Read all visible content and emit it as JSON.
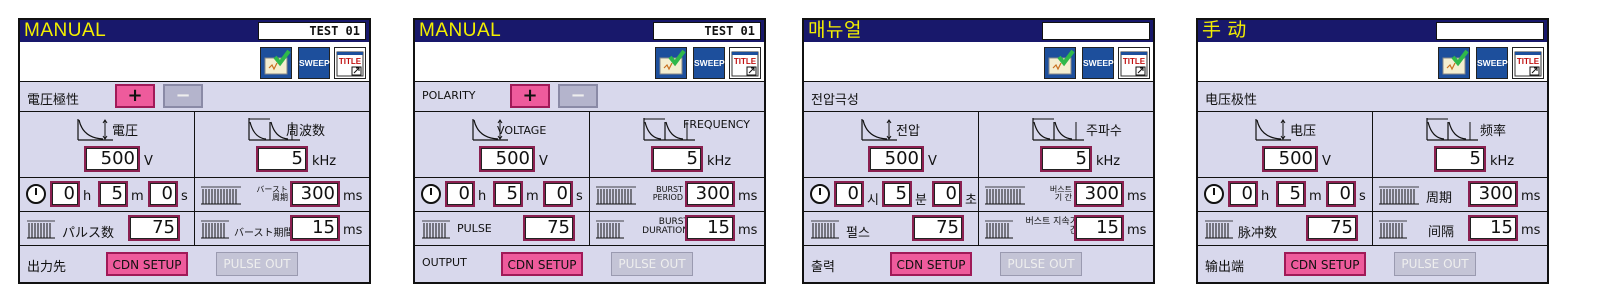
{
  "icons": {
    "calibrate": "calibration-icon",
    "sweep_label": "SWEEP",
    "title_label": "TITLE"
  },
  "colors": {
    "titlebar": "#18186b",
    "mode_text": "#f4f000",
    "active": "#ee5b9c",
    "inactive": "#b4b4cc",
    "panel_bg": "#d8d8ec"
  },
  "panels": [
    {
      "mode": "MANUAL",
      "test": "TEST 01",
      "polarity": "電圧極性",
      "plus": "+",
      "minus": "−",
      "voltage": "電圧",
      "frequency": "周波数",
      "volt_value": "500",
      "volt_unit": "V",
      "freq_value": "5",
      "freq_unit": "kHz",
      "h_value": "0",
      "h_unit": "h",
      "m_value": "5",
      "m_unit": "m",
      "s_value": "0",
      "s_unit": "s",
      "burst_period_1": "バースト",
      "burst_period_2": "周期",
      "burst_period_value": "300",
      "ms1": "ms",
      "pulse": "パルス数",
      "pulse_value": "75",
      "burst_dur": "バースト期間",
      "burst_dur_value": "15",
      "ms2": "ms",
      "output": "出力先",
      "cdn": "CDN SETUP",
      "pulse_out": "PULSE OUT"
    },
    {
      "mode": "MANUAL",
      "test": "TEST 01",
      "polarity": "POLARITY",
      "plus": "+",
      "minus": "−",
      "voltage": "VOLTAGE",
      "frequency": "FREQUENCY",
      "volt_value": "500",
      "volt_unit": "V",
      "freq_value": "5",
      "freq_unit": "kHz",
      "h_value": "0",
      "h_unit": "h",
      "m_value": "5",
      "m_unit": "m",
      "s_value": "0",
      "s_unit": "s",
      "burst_period_1": "BURST",
      "burst_period_2": "PERIOD",
      "burst_period_value": "300",
      "ms1": "ms",
      "pulse": "PULSE",
      "pulse_value": "75",
      "burst_dur": "BURST DURATION",
      "burst_dur_value": "15",
      "ms2": "ms",
      "output": "OUTPUT",
      "cdn": "CDN SETUP",
      "pulse_out": "PULSE OUT"
    },
    {
      "mode": "매뉴얼",
      "test": "",
      "polarity": "전압극성",
      "plus": "",
      "minus": "",
      "voltage": "전압",
      "frequency": "주파수",
      "volt_value": "500",
      "volt_unit": "V",
      "freq_value": "5",
      "freq_unit": "kHz",
      "h_value": "0",
      "h_unit": "시",
      "m_value": "5",
      "m_unit": "분",
      "s_value": "0",
      "s_unit": "초",
      "burst_period_1": "버스트",
      "burst_period_2": "기 간",
      "burst_period_value": "300",
      "ms1": "ms",
      "pulse": "펄스",
      "pulse_value": "75",
      "burst_dur": "버스트 지속기간",
      "burst_dur_value": "15",
      "ms2": "ms",
      "output": "출력",
      "cdn": "CDN SETUP",
      "pulse_out": "PULSE OUT"
    },
    {
      "mode": "手 动",
      "test": "",
      "polarity": "电压极性",
      "plus": "",
      "minus": "",
      "voltage": "电压",
      "frequency": "频率",
      "volt_value": "500",
      "volt_unit": "V",
      "freq_value": "5",
      "freq_unit": "kHz",
      "h_value": "0",
      "h_unit": "h",
      "m_value": "5",
      "m_unit": "m",
      "s_value": "0",
      "s_unit": "s",
      "burst_period_1": "",
      "burst_period_2": "周期",
      "burst_period_value": "300",
      "ms1": "ms",
      "pulse": "脉冲数",
      "pulse_value": "75",
      "burst_dur": "间隔",
      "burst_dur_value": "15",
      "ms2": "ms",
      "output": "输出端",
      "cdn": "CDN SETUP",
      "pulse_out": "PULSE OUT"
    }
  ]
}
